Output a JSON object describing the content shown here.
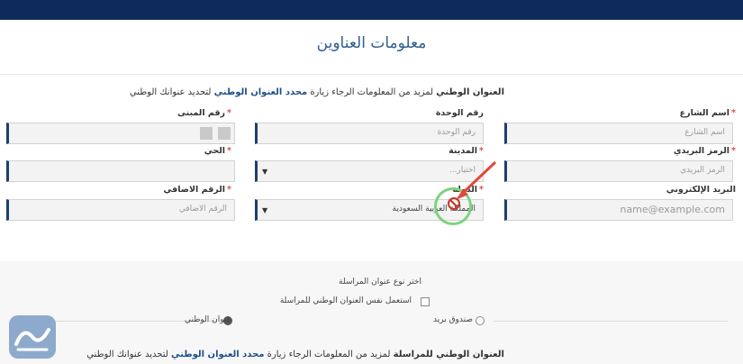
{
  "header": {
    "title": "معلومات العناوين"
  },
  "note_top": {
    "prefix": "العنوان الوطني",
    "middle": " لمزيد من المعلومات الرجاء زيارة ",
    "link": "محدد العنوان الوطني",
    "suffix": " لتحديد عنوانك الوطني"
  },
  "fields": {
    "street_name": {
      "label": "اسم الشارع",
      "placeholder": "اسم الشارع"
    },
    "unit_number": {
      "label": "رقم الوحدة",
      "placeholder": "رقم الوحدة"
    },
    "building_number": {
      "label": "رقم المبنى"
    },
    "postal_code": {
      "label": "الرمز البريدي",
      "placeholder": "الرمز البريدي"
    },
    "city": {
      "label": "المدينة",
      "placeholder": "اختيار..."
    },
    "district": {
      "label": "الحي"
    },
    "email": {
      "label": "البريد الإلكتروني",
      "placeholder": "name@example.com"
    },
    "country": {
      "label": "الدولة",
      "value": "المملكة العربية السعودية"
    },
    "additional_number": {
      "label": "الرقم الاضافي",
      "placeholder": "الرقم الاضافي"
    }
  },
  "mailing": {
    "choose_label": "اختر نوع عنوان المراسلة",
    "use_national_label": "استعمل نفس العنوان الوطني للمراسلة",
    "radio_po_box": "صندوق بريد",
    "radio_national": "عنوان الوطني"
  },
  "note_bottom": {
    "prefix": "العنوان الوطني للمراسلة",
    "middle": " لمزيد من المعلومات الرجاء زيارة ",
    "link": "محدد العنوان الوطني",
    "suffix": " لتحديد عنوانك الوطني"
  },
  "colors": {
    "accent": "#1c3f6e",
    "required": "#d9534f",
    "cursor_ring": "#7ed37e"
  },
  "icons": {
    "dropdown": "caret-down-icon",
    "cursor": "not-allowed-cursor-icon"
  }
}
